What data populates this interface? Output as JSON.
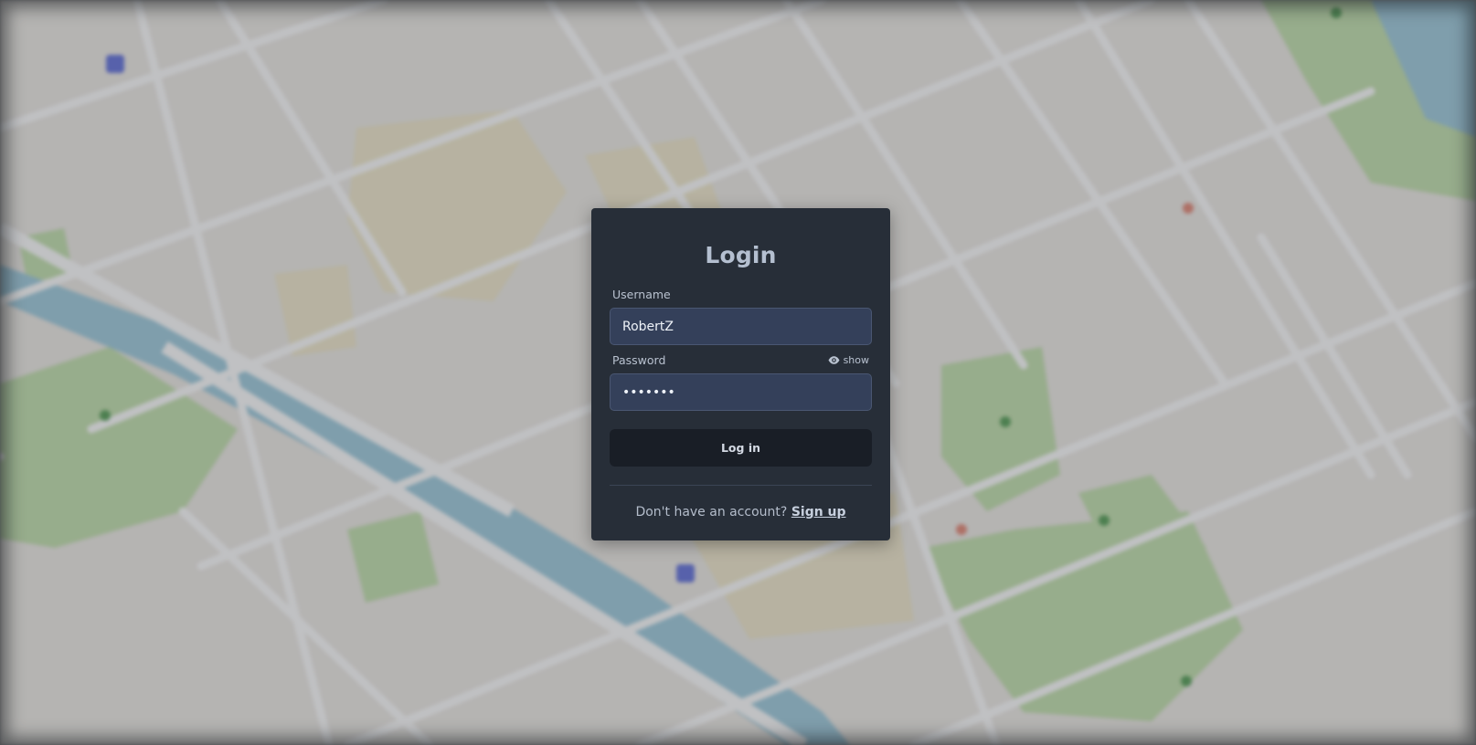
{
  "login": {
    "title": "Login",
    "username_label": "Username",
    "username_value": "RobertZ",
    "password_label": "Password",
    "password_value": "•••••••",
    "show_label": "show",
    "submit_label": "Log in",
    "signup_prompt": "Don't have an account?",
    "signup_link": "Sign up"
  },
  "icons": {
    "show_toggle": "eye-icon"
  },
  "colors": {
    "card_background": "#272e38",
    "input_background": "#34405a",
    "button_background": "#191e26",
    "map_water": "#4e9ab8",
    "map_park": "#9fd17c"
  }
}
